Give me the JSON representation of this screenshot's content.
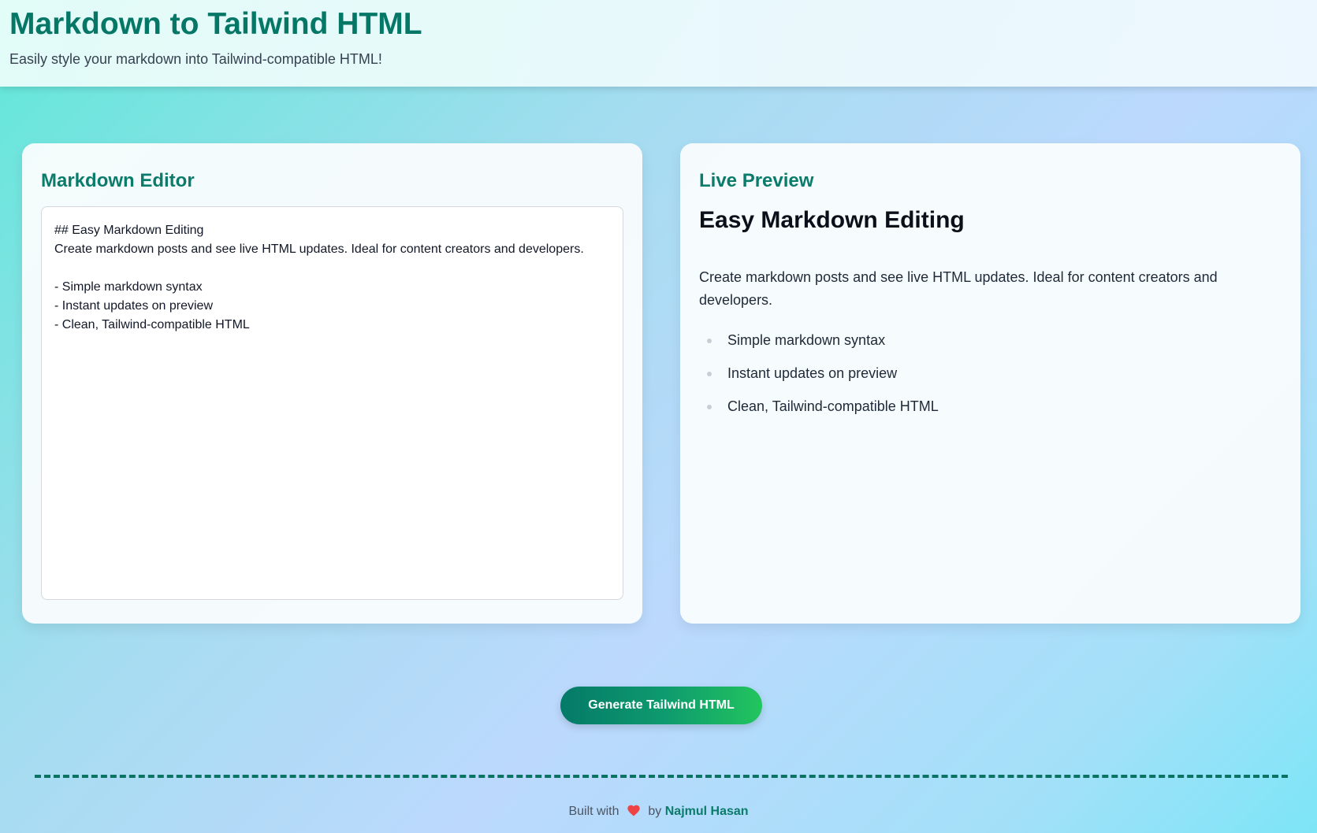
{
  "header": {
    "title": "Markdown to Tailwind HTML",
    "subtitle": "Easily style your markdown into Tailwind-compatible HTML!"
  },
  "editor": {
    "title": "Markdown Editor",
    "content": "## Easy Markdown Editing\nCreate markdown posts and see live HTML updates. Ideal for content creators and developers.\n\n- Simple markdown syntax\n- Instant updates on preview\n- Clean, Tailwind-compatible HTML"
  },
  "preview": {
    "title": "Live Preview",
    "heading": "Easy Markdown Editing",
    "paragraph": "Create markdown posts and see live HTML updates. Ideal for content creators and developers.",
    "items": [
      "Simple markdown syntax",
      "Instant updates on preview",
      "Clean, Tailwind-compatible HTML"
    ]
  },
  "actions": {
    "generate_label": "Generate Tailwind HTML"
  },
  "footer": {
    "prefix": "Built with",
    "heart_icon": "heart-icon",
    "by": "by",
    "author": "Najmul Hasan"
  },
  "colors": {
    "brand": "#047766",
    "heart": "#ef4444"
  }
}
